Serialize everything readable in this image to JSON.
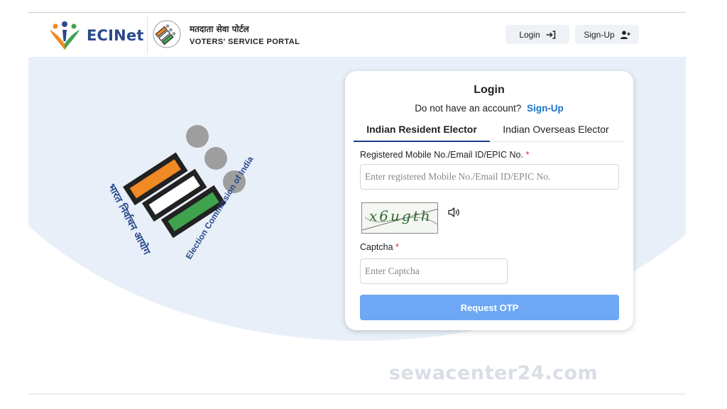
{
  "header": {
    "brand_name": "ECINet",
    "portal_title_hindi": "मतदाता सेवा पोर्टल",
    "portal_title_english": "VOTERS' SERVICE PORTAL",
    "login_label": "Login",
    "signup_label": "Sign-Up"
  },
  "login_card": {
    "title": "Login",
    "no_account_text": "Do not have an account?",
    "signup_link": "Sign-Up",
    "tabs": [
      {
        "label": "Indian Resident Elector",
        "active": true
      },
      {
        "label": "Indian Overseas Elector",
        "active": false
      }
    ],
    "id_field": {
      "label": "Registered Mobile No./Email ID/EPIC No.",
      "required_mark": "*",
      "placeholder": "Enter registered Mobile No./Email ID/EPIC No.",
      "value": ""
    },
    "captcha_image_text": "x6ugth",
    "captcha_field": {
      "label": "Captcha",
      "required_mark": "*",
      "placeholder": "Enter Captcha",
      "value": ""
    },
    "submit_label": "Request OTP"
  },
  "seal": {
    "hindi_text": "भारत निर्वाचन आयोग",
    "english_text": "Election Commission of India"
  },
  "watermark": "sewacenter24.com",
  "colors": {
    "brand_blue": "#2a4a8c",
    "link_blue": "#1a73c9",
    "button_blue": "#6ea7f3",
    "hero_bg": "#e8eff9",
    "required_red": "#d32f2f",
    "tab_underline": "#1e3a8a"
  },
  "icons": {
    "login": "login-arrow-icon",
    "signup": "person-add-icon",
    "audio": "speaker-icon"
  }
}
